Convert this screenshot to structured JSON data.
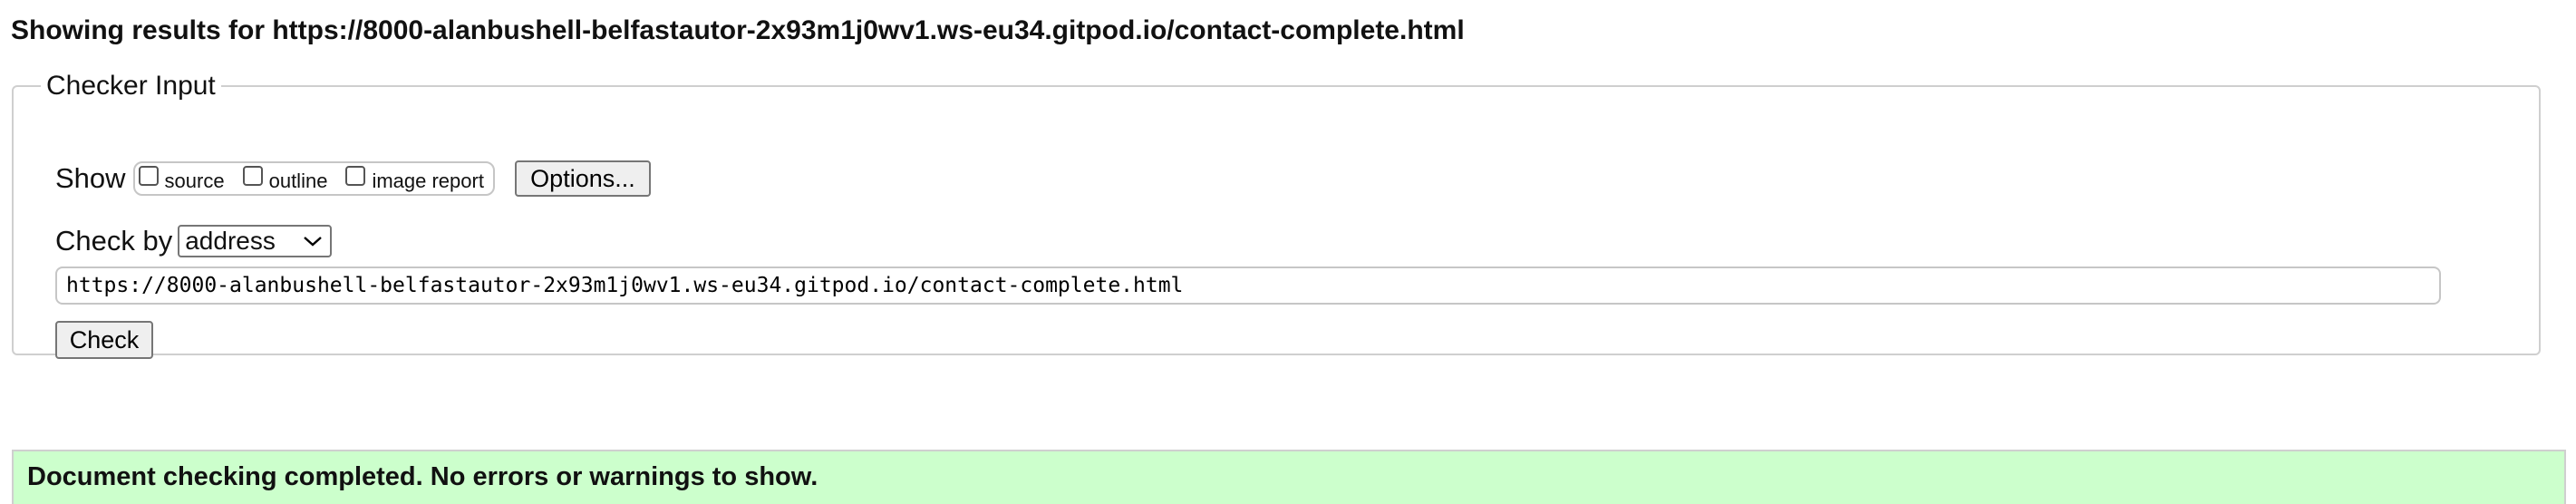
{
  "heading": {
    "text": "Showing results for https://8000-alanbushell-belfastautor-2x93m1j0wv1.ws-eu34.gitpod.io/contact-complete.html"
  },
  "checker": {
    "legend": "Checker Input",
    "show_label": "Show",
    "options": [
      {
        "label": "source",
        "checked": false
      },
      {
        "label": "outline",
        "checked": false
      },
      {
        "label": "image report",
        "checked": false
      }
    ],
    "options_button": "Options...",
    "check_by_label": "Check by",
    "check_by_value": "address",
    "url_value": "https://8000-alanbushell-belfastautor-2x93m1j0wv1.ws-eu34.gitpod.io/contact-complete.html",
    "check_button": "Check"
  },
  "result": {
    "message": "Document checking completed. No errors or warnings to show.",
    "background": "#ccffcc"
  }
}
